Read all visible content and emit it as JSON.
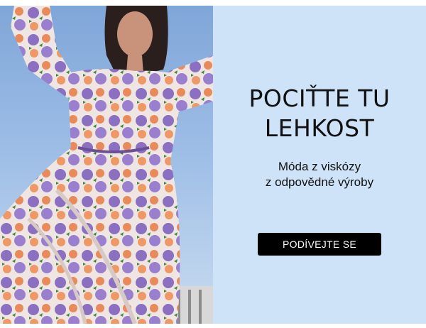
{
  "banner": {
    "headline": "POCIŤTE TU\nLEHKOST",
    "subheadline": "Móda z viskózy\nz odpovědné výroby",
    "cta_label": "PODÍVEJTE SE"
  },
  "photo": {
    "description_icon": "model-in-floral-dress-image"
  },
  "colors": {
    "panel_background": "#cfe3f8",
    "button_background": "#000000",
    "button_text": "#ffffff",
    "text": "#111111"
  }
}
